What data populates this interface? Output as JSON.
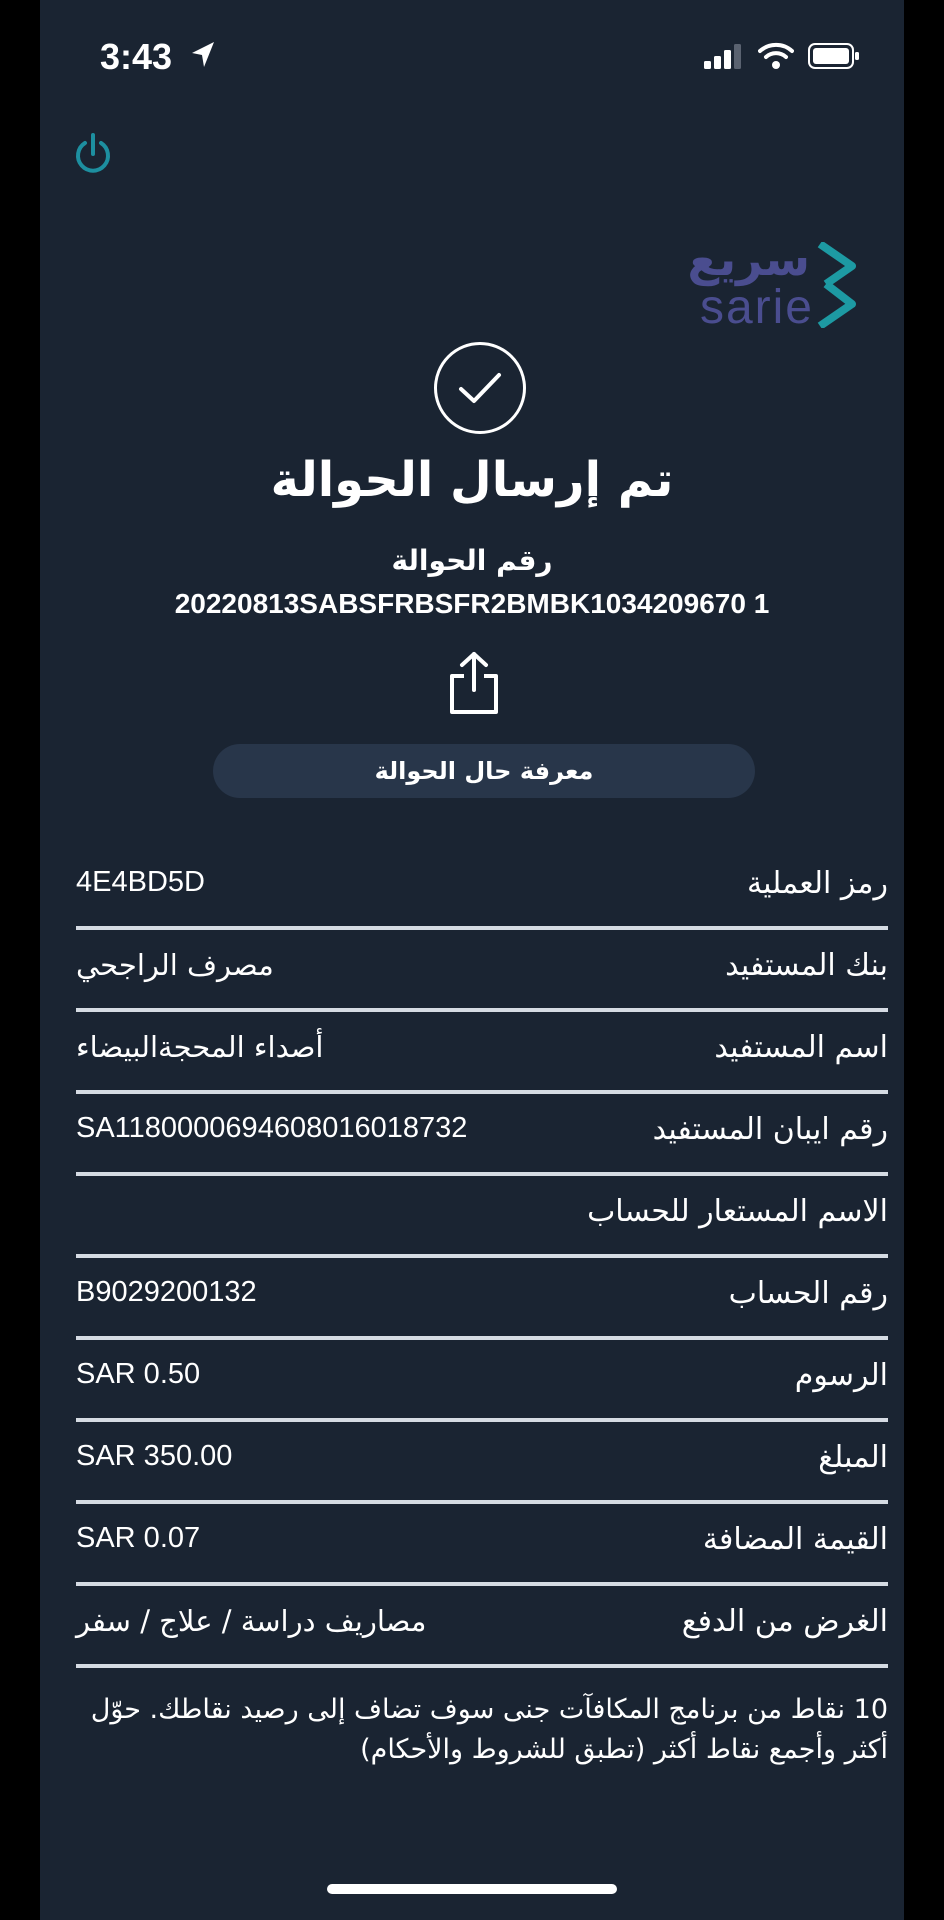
{
  "status_bar": {
    "time": "3:43",
    "icons": [
      "location-arrow-icon",
      "signal-icon",
      "wifi-icon",
      "battery-icon"
    ]
  },
  "header": {
    "power_icon": "power-icon",
    "logo_arabic": "سريع",
    "logo_latin": "sarie"
  },
  "confirmation": {
    "icon": "checkmark-icon",
    "title": "تم إرسال الحوالة",
    "reference_label": "رقم الحوالة",
    "reference_number": "20220813SABSFRBSFR2BMBK1034209670 1",
    "share_icon": "share-icon",
    "status_button": "معرفة حال الحوالة"
  },
  "details": [
    {
      "label": "رمز العملية",
      "value": "4E4BD5D"
    },
    {
      "label": "بنك المستفيد",
      "value": "مصرف الراجحي"
    },
    {
      "label": "اسم المستفيد",
      "value": "أصداء المحجةالبيضاء"
    },
    {
      "label": "رقم ايبان المستفيد",
      "value": "SA1180000694608016018732"
    },
    {
      "label": "الاسم المستعار للحساب",
      "value": ""
    },
    {
      "label": "رقم الحساب",
      "value": "B9029200132"
    },
    {
      "label": "الرسوم",
      "value": "SAR 0.50"
    },
    {
      "label": "المبلغ",
      "value": "SAR 350.00"
    },
    {
      "label": "القيمة المضافة",
      "value": "SAR 0.07"
    },
    {
      "label": "الغرض من الدفع",
      "value": "مصاريف دراسة / علاج / سفر"
    }
  ],
  "footer_note": "10 نقاط من برنامج المكافآت جنى سوف تضاف إلى رصيد نقاطك. حوّل أكثر وأجمع نقاط أكثر (تطبق للشروط والأحكام)",
  "colors": {
    "background": "#1a2432",
    "button": "#28364a",
    "divider": "#d5dbe3",
    "logo_purple": "#4a4d8f",
    "logo_teal": "#1d9aa3"
  }
}
